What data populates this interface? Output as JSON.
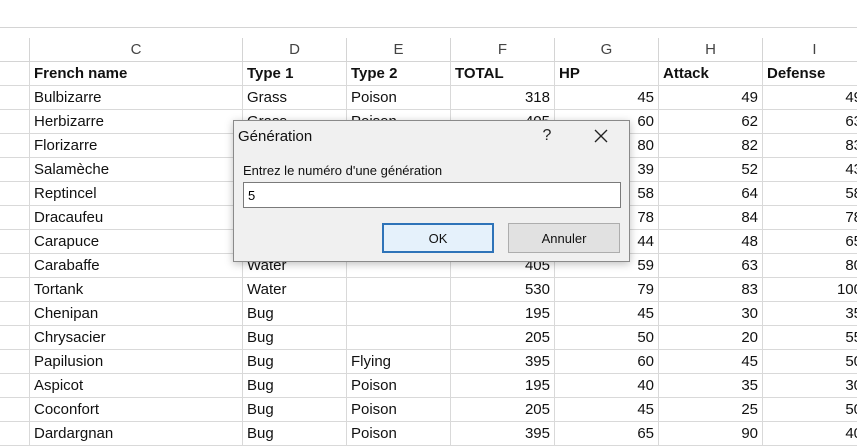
{
  "columns": [
    {
      "letter": "C"
    },
    {
      "letter": "D"
    },
    {
      "letter": "E"
    },
    {
      "letter": "F"
    },
    {
      "letter": "G"
    },
    {
      "letter": "H"
    },
    {
      "letter": "I"
    }
  ],
  "headers": [
    "French name",
    "Type 1",
    "Type 2",
    "TOTAL",
    "HP",
    "Attack",
    "Defense"
  ],
  "rows": [
    [
      "Bulbizarre",
      "Grass",
      "Poison",
      "318",
      "45",
      "49",
      "49"
    ],
    [
      "Herbizarre",
      "Grass",
      "Poison",
      "405",
      "60",
      "62",
      "63"
    ],
    [
      "Florizarre",
      "",
      "",
      "",
      "80",
      "82",
      "83"
    ],
    [
      "Salamèche",
      "",
      "",
      "",
      "39",
      "52",
      "43"
    ],
    [
      "Reptincel",
      "",
      "",
      "",
      "58",
      "64",
      "58"
    ],
    [
      "Dracaufeu",
      "",
      "",
      "",
      "78",
      "84",
      "78"
    ],
    [
      "Carapuce",
      "",
      "",
      "",
      "44",
      "48",
      "65"
    ],
    [
      "Carabaffe",
      "Water",
      "",
      "405",
      "59",
      "63",
      "80"
    ],
    [
      "Tortank",
      "Water",
      "",
      "530",
      "79",
      "83",
      "100"
    ],
    [
      "Chenipan",
      "Bug",
      "",
      "195",
      "45",
      "30",
      "35"
    ],
    [
      "Chrysacier",
      "Bug",
      "",
      "205",
      "50",
      "20",
      "55"
    ],
    [
      "Papilusion",
      "Bug",
      "Flying",
      "395",
      "60",
      "45",
      "50"
    ],
    [
      "Aspicot",
      "Bug",
      "Poison",
      "195",
      "40",
      "35",
      "30"
    ],
    [
      "Coconfort",
      "Bug",
      "Poison",
      "205",
      "45",
      "25",
      "50"
    ],
    [
      "Dardargnan",
      "Bug",
      "Poison",
      "395",
      "65",
      "90",
      "40"
    ]
  ],
  "dialog": {
    "title": "Génération",
    "help": "?",
    "prompt": "Entrez le numéro d'une génération",
    "input_value": "5",
    "ok_label": "OK",
    "cancel_label": "Annuler"
  }
}
